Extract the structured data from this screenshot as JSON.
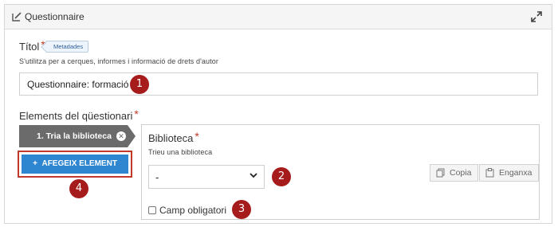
{
  "panel": {
    "title": "Questionnaire"
  },
  "title_field": {
    "label": "Títol",
    "required_mark": "*",
    "tag": "Metadades",
    "help": "S'utilitza per a cerques, informes i informació de drets d'autor",
    "value": "Questionnaire: formació"
  },
  "elements": {
    "label": "Elements del qüestionari",
    "required_mark": "*",
    "step_tab_label": "1. Tria la biblioteca",
    "add_button_label": "AFEGEIX ELEMENT",
    "add_button_icon": "+"
  },
  "library": {
    "label": "Biblioteca",
    "required_mark": "*",
    "help": "Trieu una biblioteca",
    "selected": "-",
    "copy_label": "Copia",
    "paste_label": "Enganxa",
    "required_checkbox_label": "Camp obligatori",
    "required_checked": false
  },
  "annotations": [
    "1",
    "2",
    "3",
    "4"
  ],
  "colors": {
    "accent_blue": "#2e86d0",
    "required_red": "#c0392b",
    "badge_red": "#a61b1b",
    "tab_gray": "#6b6b6b"
  }
}
